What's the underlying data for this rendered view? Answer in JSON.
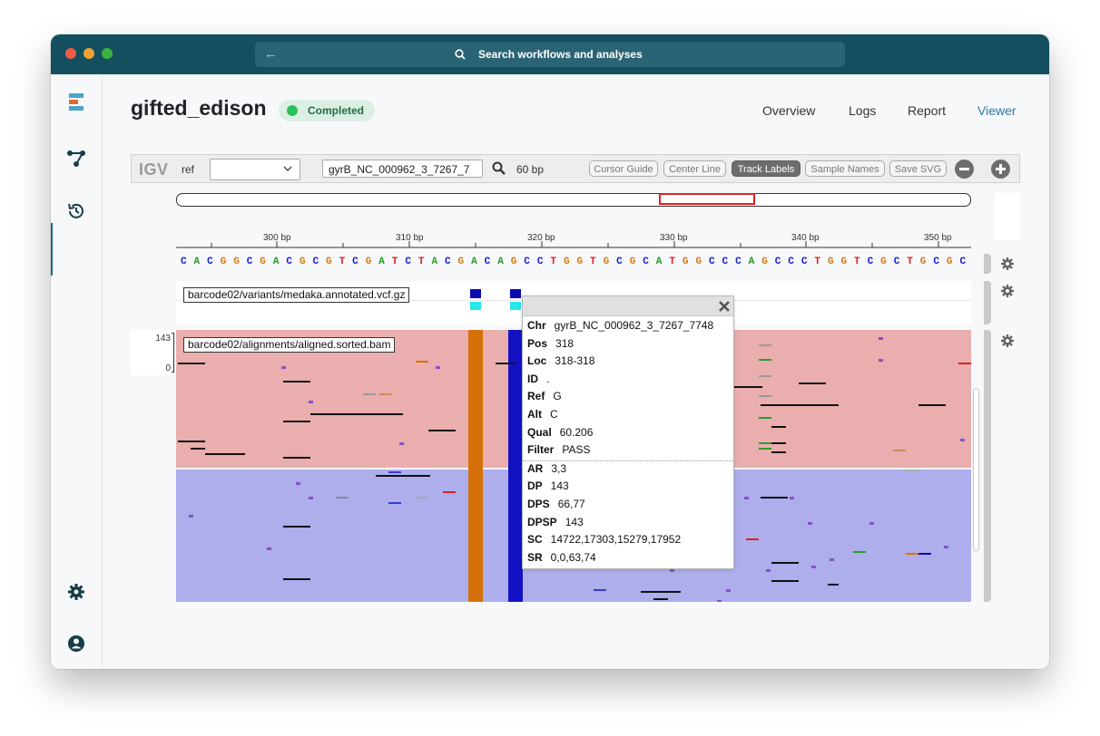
{
  "window": {
    "search_placeholder": "Search workflows and analyses"
  },
  "sidebar": {
    "icons": [
      "logo-icon",
      "workflow-icon",
      "history-icon",
      "settings-icon",
      "account-icon"
    ]
  },
  "header": {
    "run_name": "gifted_edison",
    "status": "Completed",
    "tabs": [
      "Overview",
      "Logs",
      "Report",
      "Viewer"
    ],
    "active_tab": "Viewer"
  },
  "igv": {
    "logo": "IGV",
    "ref_label": "ref",
    "ref_value": "",
    "locus": "gyrB_NC_000962_3_7267_7748:318",
    "locus_display": "gyrB_NC_000962_3_7267_7",
    "width_label": "60 bp",
    "buttons": [
      "Cursor Guide",
      "Center Line",
      "Track Labels",
      "Sample Names",
      "Save SVG"
    ],
    "active_button": "Track Labels",
    "ruler_ticks": [
      "300 bp",
      "310 bp",
      "320 bp",
      "330 bp",
      "340 bp",
      "350 bp"
    ],
    "sequence": "CACGGCGACGCGTCGATCTACGACAGCCTGGTGCGCATGGCCCAGCCCTGGTCGCTGCGC",
    "tracks": {
      "vcf": "barcode02/variants/medaka.annotated.vcf.gz",
      "bam": "barcode02/alignments/aligned.sorted.bam",
      "bam_scale_max": "143",
      "bam_scale_min": "0"
    }
  },
  "popup": {
    "fields": [
      {
        "key": "Chr",
        "value": "gyrB_NC_000962_3_7267_7748"
      },
      {
        "key": "Pos",
        "value": "318"
      },
      {
        "key": "Loc",
        "value": "318-318"
      },
      {
        "key": "ID",
        "value": "."
      },
      {
        "key": "Ref",
        "value": "G"
      },
      {
        "key": "Alt",
        "value": "C"
      },
      {
        "key": "Qual",
        "value": "60.206"
      },
      {
        "key": "Filter",
        "value": "PASS"
      },
      {
        "key": "AR",
        "value": "3,3"
      },
      {
        "key": "DP",
        "value": "143"
      },
      {
        "key": "DPS",
        "value": "66,77"
      },
      {
        "key": "DPSP",
        "value": "143"
      },
      {
        "key": "SC",
        "value": "14722,17303,15279,17952"
      },
      {
        "key": "SR",
        "value": "0,0,63,74"
      }
    ]
  },
  "colors": {
    "titlebar": "#134f5e",
    "accent": "#1e6b80",
    "base_A": "#1aa31a",
    "base_C": "#1a1ad6",
    "base_G": "#d1781a",
    "base_T": "#e01a1a",
    "forward_strand": "#eaaeae",
    "reverse_strand": "#adaeeb"
  }
}
